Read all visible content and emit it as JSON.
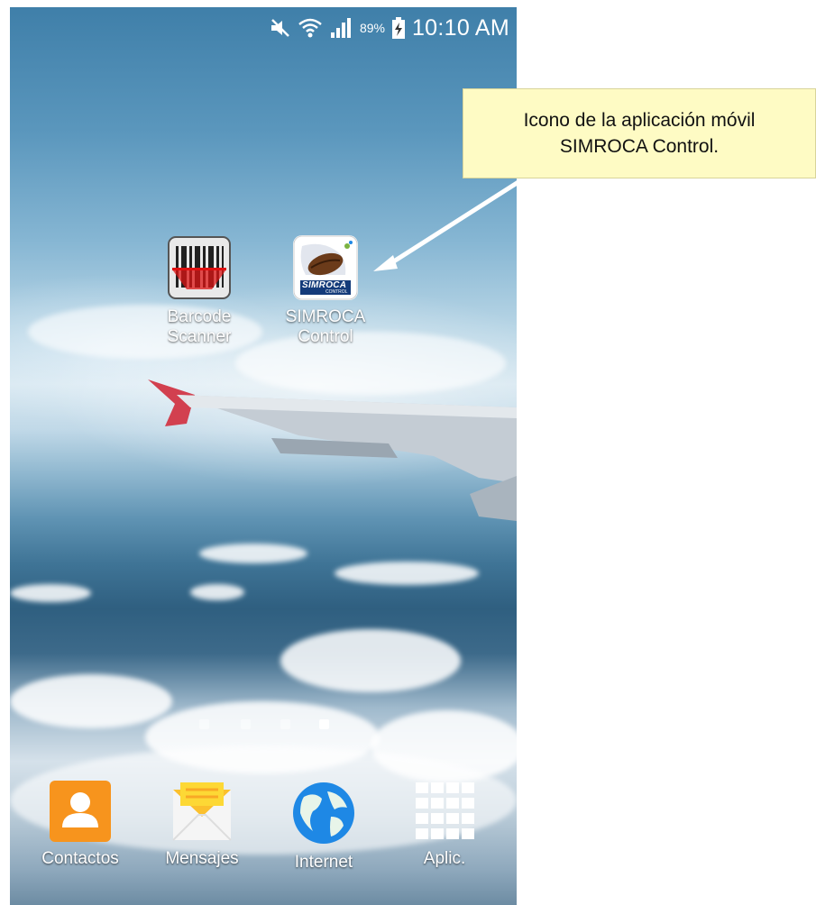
{
  "status_bar": {
    "battery_percent": "89%",
    "time": "10:10 AM",
    "icons": [
      "mute-icon",
      "wifi-icon",
      "signal-icon",
      "battery-charging-icon"
    ]
  },
  "home_apps": [
    {
      "label_line1": "Barcode",
      "label_line2": "Scanner",
      "icon": "barcode-scanner-icon"
    },
    {
      "label_line1": "SIMROCA",
      "label_line2": "Control",
      "icon": "simroca-control-icon",
      "icon_text": "SIMROCA",
      "icon_subtext": "CONTROL"
    }
  ],
  "page_indicator": {
    "pages": 4,
    "active": 4
  },
  "dock": [
    {
      "label": "Contactos",
      "icon": "contacts-icon"
    },
    {
      "label": "Mensajes",
      "icon": "messages-icon"
    },
    {
      "label": "Internet",
      "icon": "globe-icon"
    },
    {
      "label": "Aplic.",
      "icon": "apps-grid-icon"
    }
  ],
  "callout": {
    "line1": "Icono de la aplicación móvil",
    "line2": "SIMROCA Control."
  }
}
